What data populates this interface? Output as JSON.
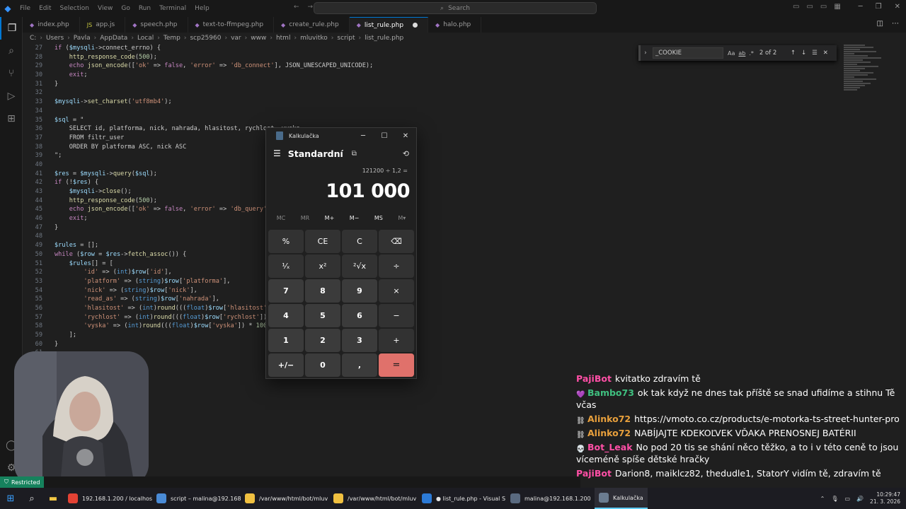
{
  "titlebar": {
    "menu": [
      "File",
      "Edit",
      "Selection",
      "View",
      "Go",
      "Run",
      "Terminal",
      "Help"
    ],
    "search_placeholder": "Search"
  },
  "tabs": [
    {
      "label": "index.php",
      "type": "php"
    },
    {
      "label": "app.js",
      "type": "js"
    },
    {
      "label": "speech.php",
      "type": "php"
    },
    {
      "label": "text-to-ffmpeg.php",
      "type": "php"
    },
    {
      "label": "create_rule.php",
      "type": "php"
    },
    {
      "label": "list_rule.php",
      "type": "php",
      "active": true,
      "modified": true
    },
    {
      "label": "halo.php",
      "type": "php"
    }
  ],
  "breadcrumb": [
    "C:",
    "Users",
    "Pavla",
    "AppData",
    "Local",
    "Temp",
    "scp25960",
    "var",
    "www",
    "html",
    "mluvitko",
    "script",
    "list_rule.php"
  ],
  "find": {
    "query": "_COOKIE",
    "match_case": "Aa",
    "whole_word": "ab",
    "regex": ".*",
    "count": "2 of 2"
  },
  "code": [
    {
      "n": "27",
      "t": "if ($mysqli->connect_errno) {"
    },
    {
      "n": "28",
      "t": "    http_response_code(500);"
    },
    {
      "n": "29",
      "t": "    echo json_encode(['ok' => false, 'error' => 'db_connect'], JSON_UNESCAPED_UNICODE);"
    },
    {
      "n": "30",
      "t": "    exit;"
    },
    {
      "n": "31",
      "t": "}"
    },
    {
      "n": "32",
      "t": ""
    },
    {
      "n": "33",
      "t": "$mysqli->set_charset('utf8mb4');"
    },
    {
      "n": "34",
      "t": ""
    },
    {
      "n": "35",
      "t": "$sql = \""
    },
    {
      "n": "36",
      "t": "    SELECT id, platforma, nick, nahrada, hlasitost, rychlost, vyska"
    },
    {
      "n": "37",
      "t": "    FROM filtr_user"
    },
    {
      "n": "38",
      "t": "    ORDER BY platforma ASC, nick ASC"
    },
    {
      "n": "39",
      "t": "\";"
    },
    {
      "n": "40",
      "t": ""
    },
    {
      "n": "41",
      "t": "$res = $mysqli->query($sql);"
    },
    {
      "n": "42",
      "t": "if (!$res) {"
    },
    {
      "n": "43",
      "t": "    $mysqli->close();"
    },
    {
      "n": "44",
      "t": "    http_response_code(500);"
    },
    {
      "n": "45",
      "t": "    echo json_encode(['ok' => false, 'error' => 'db_query'"
    },
    {
      "n": "46",
      "t": "    exit;"
    },
    {
      "n": "47",
      "t": "}"
    },
    {
      "n": "48",
      "t": ""
    },
    {
      "n": "49",
      "t": "$rules = [];"
    },
    {
      "n": "50",
      "t": "while ($row = $res->fetch_assoc()) {"
    },
    {
      "n": "51",
      "t": "    $rules[] = ["
    },
    {
      "n": "52",
      "t": "        'id' => (int)$row['id'],"
    },
    {
      "n": "53",
      "t": "        'platform' => (string)$row['platforma'],"
    },
    {
      "n": "54",
      "t": "        'nick' => (string)$row['nick'],"
    },
    {
      "n": "55",
      "t": "        'read_as' => (string)$row['nahrada'],"
    },
    {
      "n": "56",
      "t": "        'hlasitost' => (int)round(((float)$row['hlasitost'"
    },
    {
      "n": "57",
      "t": "        'rychlost' => (int)round(((float)$row['rychlost'])"
    },
    {
      "n": "58",
      "t": "        'vyska' => (int)round(((float)$row['vyska']) * 100"
    },
    {
      "n": "59",
      "t": "    ];"
    },
    {
      "n": "60",
      "t": "}"
    },
    {
      "n": "61",
      "t": ""
    },
    {
      "n": "",
      "t": ""
    },
    {
      "n": "",
      "t": ""
    },
    {
      "n": "",
      "t": ""
    },
    {
      "n": "",
      "t": ""
    },
    {
      "n": "",
      "t": "                  ;"
    }
  ],
  "calculator": {
    "window_title": "Kalkulačka",
    "mode": "Standardní",
    "expression": "121200 ÷ 1,2 =",
    "display": "101 000",
    "memory": [
      "MC",
      "MR",
      "M+",
      "M−",
      "MS",
      "M▾"
    ],
    "keys": [
      {
        "label": "%",
        "kind": "op"
      },
      {
        "label": "CE",
        "kind": "op"
      },
      {
        "label": "C",
        "kind": "op"
      },
      {
        "label": "⌫",
        "kind": "op"
      },
      {
        "label": "¹⁄ₓ",
        "kind": "op"
      },
      {
        "label": "x²",
        "kind": "op"
      },
      {
        "label": "²√x",
        "kind": "op"
      },
      {
        "label": "÷",
        "kind": "op"
      },
      {
        "label": "7",
        "kind": "num"
      },
      {
        "label": "8",
        "kind": "num"
      },
      {
        "label": "9",
        "kind": "num"
      },
      {
        "label": "×",
        "kind": "op"
      },
      {
        "label": "4",
        "kind": "num"
      },
      {
        "label": "5",
        "kind": "num"
      },
      {
        "label": "6",
        "kind": "num"
      },
      {
        "label": "−",
        "kind": "op"
      },
      {
        "label": "1",
        "kind": "num"
      },
      {
        "label": "2",
        "kind": "num"
      },
      {
        "label": "3",
        "kind": "num"
      },
      {
        "label": "+",
        "kind": "op"
      },
      {
        "label": "+/−",
        "kind": "num"
      },
      {
        "label": "0",
        "kind": "num"
      },
      {
        "label": ",",
        "kind": "num"
      },
      {
        "label": "=",
        "kind": "eq"
      }
    ]
  },
  "chat": [
    {
      "user": "PajiBot",
      "color": "pink",
      "badge": "",
      "text": "kvitatko zdravím tě"
    },
    {
      "user": "Bambo73",
      "color": "green",
      "badge": "💜",
      "text": "ok tak když ne dnes tak příště se snad ufidíme a stihnu Tě včas"
    },
    {
      "user": "Alinko72",
      "color": "orange",
      "badge": "⛓",
      "text": "https://vmoto.co.cz/products/e-motorka-ts-street-hunter-pro"
    },
    {
      "user": "Alinko72",
      "color": "orange",
      "badge": "⛓",
      "text": "NABÍJAJTE KDEKOĽVEK VĎAKA PRENOSNEJ BATÉRII"
    },
    {
      "user": "Bot_Leak",
      "color": "pink",
      "badge": "💀",
      "text": "No pod 20 tis se shání něco těžko, a to i v této ceně to jsou víceméně spíše dětské hračky"
    },
    {
      "user": "PajiBot",
      "color": "pink",
      "badge": "",
      "text": "Darion8, maiklcz82, thedudle1, StatorY vidím tě, zdravím tě"
    }
  ],
  "statusbar": {
    "remote": "Restricted"
  },
  "taskbar": {
    "apps": [
      {
        "label": "192.168.1.200 / localhost",
        "color": "#e34234"
      },
      {
        "label": "script – malina@192.168",
        "color": "#4a8bd6"
      },
      {
        "label": "/var/www/html/bot/mluv",
        "color": "#f0c040"
      },
      {
        "label": "/var/www/html/bot/mluv",
        "color": "#f0c040"
      },
      {
        "label": "● list_rule.php - Visual S",
        "color": "#2c7ad6"
      },
      {
        "label": "malina@192.168.1.200",
        "color": "#5a6a80"
      },
      {
        "label": "Kalkulačka",
        "color": "#6b7c90",
        "active": true
      }
    ],
    "time": "10:29:47",
    "date": "21. 3. 2026"
  }
}
